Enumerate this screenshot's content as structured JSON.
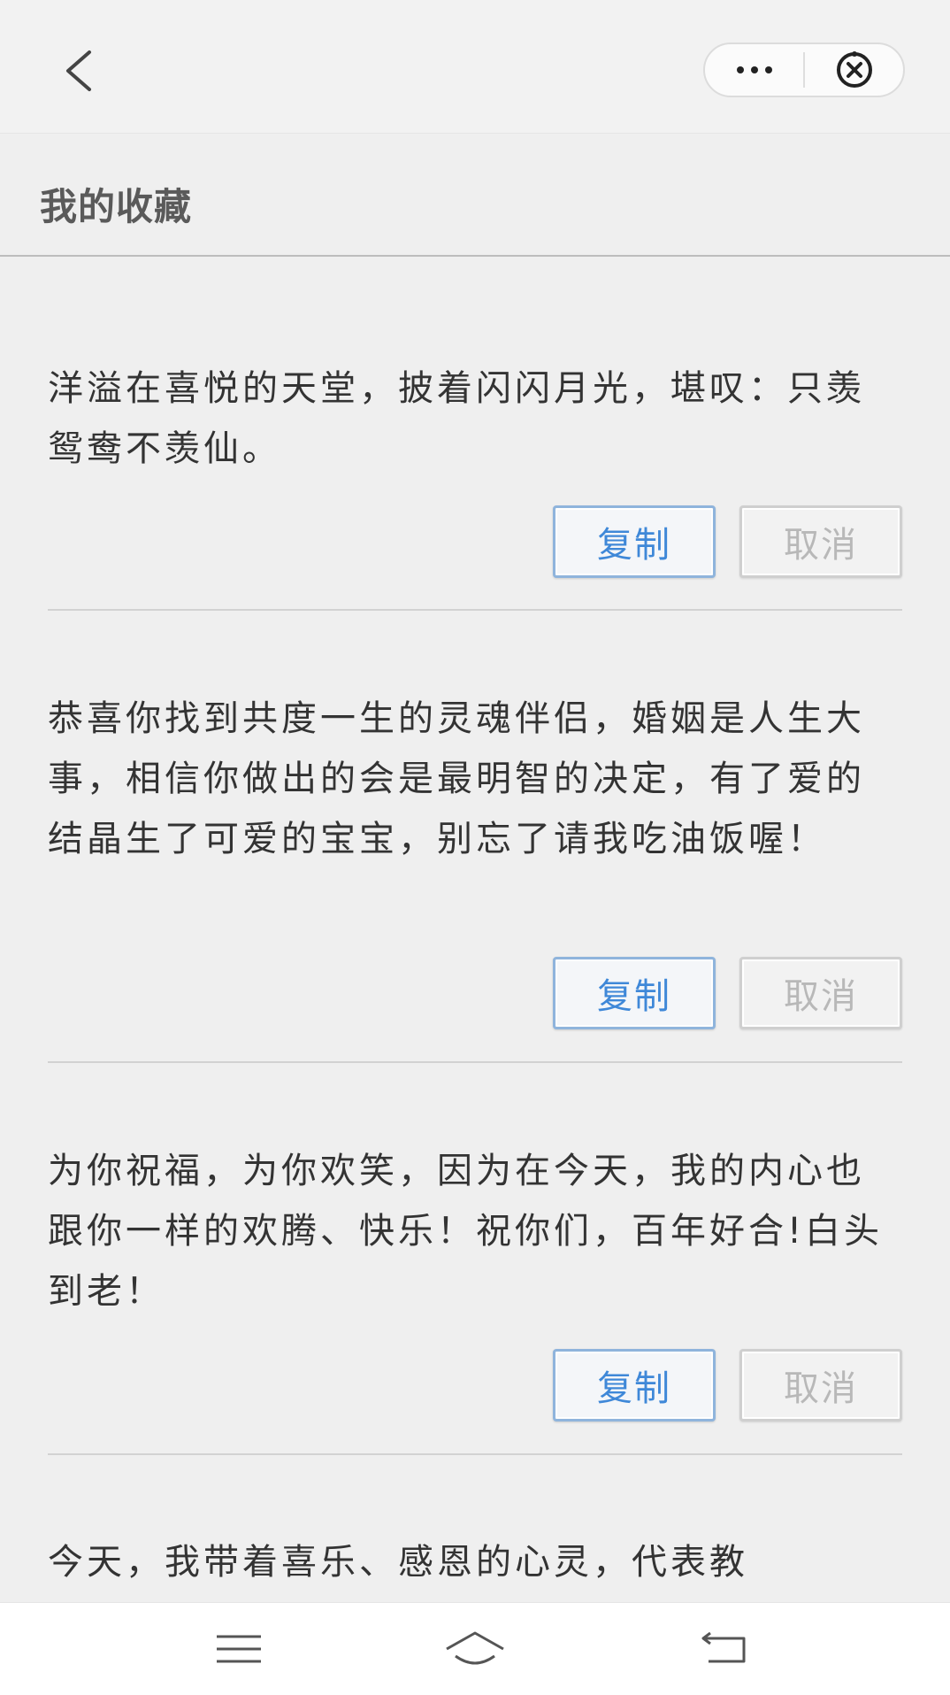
{
  "header": {
    "back_icon": "chevron-left-icon",
    "more_icon": "more-dots-icon",
    "close_icon": "close-circle-icon"
  },
  "page": {
    "title": "我的收藏"
  },
  "favorites": [
    {
      "text": "洋溢在喜悦的天堂，披着闪闪月光，堪叹：只羡鸳鸯不羡仙。",
      "copy_label": "复制",
      "cancel_label": "取消"
    },
    {
      "text": "恭喜你找到共度一生的灵魂伴侣，婚姻是人生大事，相信你做出的会是最明智的决定，有了爱的结晶生了可爱的宝宝，别忘了请我吃油饭喔！",
      "copy_label": "复制",
      "cancel_label": "取消"
    },
    {
      "text": "为你祝福，为你欢笑，因为在今天，我的内心也跟你一样的欢腾、快乐！祝你们，百年好合!白头到老！",
      "copy_label": "复制",
      "cancel_label": "取消"
    },
    {
      "text": "今天，我带着喜乐、感恩的心灵，代表教"
    }
  ],
  "colors": {
    "copy_text": "#3f88d8",
    "cancel_text": "#b8b8b8",
    "background": "#efefef"
  },
  "system_nav": {
    "menu_icon": "menu-icon",
    "home_icon": "home-icon",
    "back_icon": "back-arrow-icon"
  }
}
